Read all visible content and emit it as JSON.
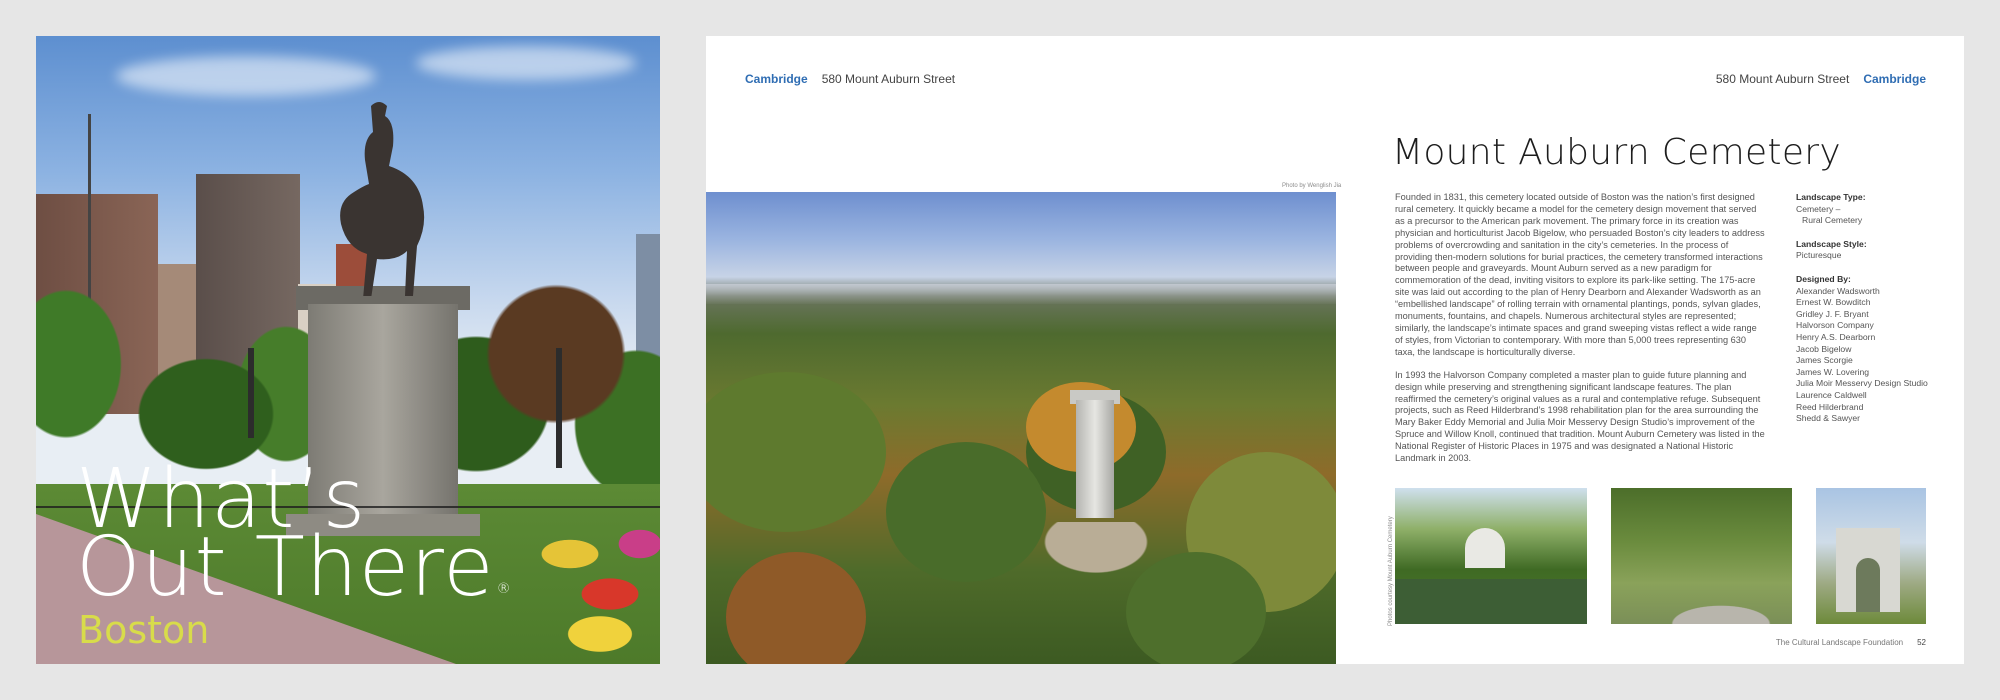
{
  "cover": {
    "title_line1": "What’s",
    "title_line2": "Out There",
    "registered_mark": "®",
    "subtitle": "Boston"
  },
  "header": {
    "city": "Cambridge",
    "address": "580 Mount Auburn Street"
  },
  "photo_credit_main": "Photo by Wenglish Jia",
  "photo_credit_vertical": "Photos courtesy Mount Auburn Cemetery",
  "title": "Mount Auburn Cemetery",
  "body": {
    "paragraph1": "Founded in 1831, this cemetery located outside of Boston was the nation’s first designed rural cemetery. It quickly became a model for the cemetery design movement that served as a precursor to the American park movement. The primary force in its creation was physician and horticulturist Jacob Bigelow, who persuaded Boston’s city leaders to address problems of overcrowding and sanitation in the city’s cemeteries. In the process of providing then-modern solutions for burial practices, the cemetery transformed interactions between people and graveyards. Mount Auburn served as a new paradigm for commemoration of the dead, inviting visitors to explore its park-like setting. The 175-acre site was laid out according to the plan of Henry Dearborn and Alexander Wadsworth as an “embellished landscape” of rolling terrain with ornamental plantings, ponds, sylvan glades, monuments, fountains, and chapels. Numerous architectural styles are represented; similarly, the landscape’s intimate spaces and grand sweeping vistas reflect a wide range of styles, from Victorian to contemporary. With more than 5,000 trees representing 630 taxa, the landscape is horticulturally diverse.",
    "paragraph2": "In 1993 the Halvorson Company completed a master plan to guide future planning and design while preserving and strengthening significant landscape features. The plan reaffirmed the cemetery’s original values as a rural and contemplative refuge. Subsequent projects, such as Reed Hilderbrand’s 1998 rehabilitation plan for the area surrounding the Mary Baker Eddy Memorial and Julia Moir Messervy Design Studio’s improvement of the Spruce and Willow Knoll, continued that tradition. Mount Auburn Cemetery was listed in the National Register of Historic Places in 1975 and was designated a National Historic Landmark in 2003."
  },
  "meta": {
    "landscape_type_label": "Landscape Type:",
    "landscape_type_value1": "Cemetery –",
    "landscape_type_value2": "Rural Cemetery",
    "landscape_style_label": "Landscape Style:",
    "landscape_style_value": "Picturesque",
    "designed_by_label": "Designed By:",
    "designers": [
      "Alexander Wadsworth",
      "Ernest W. Bowditch",
      "Gridley J. F. Bryant",
      "Halvorson Company",
      "Henry A.S. Dearborn",
      "Jacob Bigelow",
      "James Scorgie",
      "James W. Lovering",
      "Julia Moir Messervy Design Studio",
      "Laurence Caldwell",
      "Reed Hilderbrand",
      "Shedd & Sawyer"
    ]
  },
  "footer": {
    "publisher": "The Cultural Landscape Foundation",
    "page_number": "52"
  }
}
